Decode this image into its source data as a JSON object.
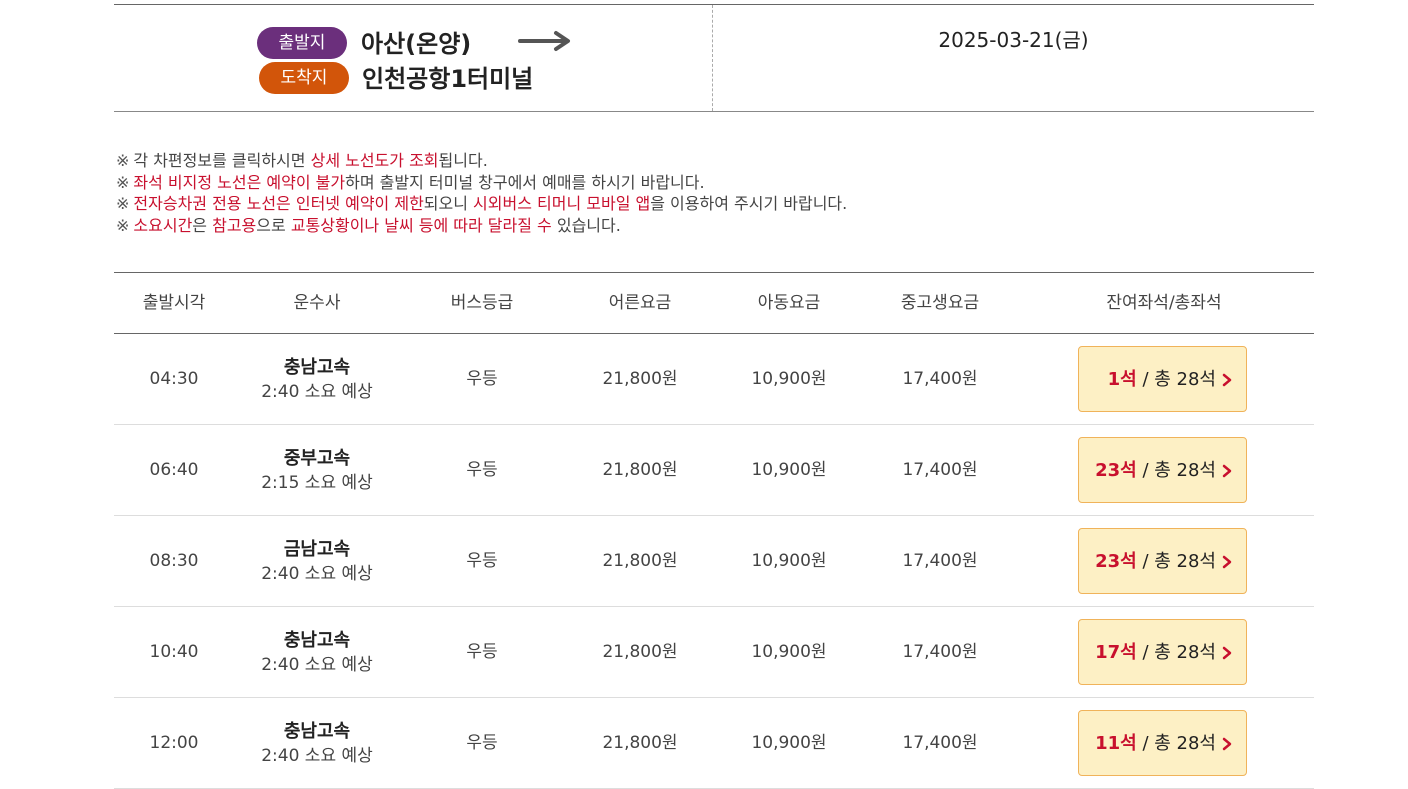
{
  "route": {
    "departure_badge": "출발지",
    "departure": "아산(온양)",
    "arrival_badge": "도착지",
    "arrival": "인천공항1터미널",
    "date": "2025-03-21(금)"
  },
  "notices": [
    [
      {
        "t": "각 차편정보를 클릭하시면 ",
        "red": false
      },
      {
        "t": "상세 노선도가 조회",
        "red": true
      },
      {
        "t": "됩니다.",
        "red": false
      }
    ],
    [
      {
        "t": "좌석 비지정 노선은 예약이 불가",
        "red": true
      },
      {
        "t": "하며 출발지 터미널 창구에서 예매를 하시기 바랍니다.",
        "red": false
      }
    ],
    [
      {
        "t": "전자승차권 전용 노선은 인터넷 예약이 제한",
        "red": true
      },
      {
        "t": "되오니 ",
        "red": false
      },
      {
        "t": "시외버스 티머니 모바일 앱",
        "red": true
      },
      {
        "t": "을 이용하여 주시기 바랍니다.",
        "red": false
      }
    ],
    [
      {
        "t": "소요시간",
        "red": true
      },
      {
        "t": "은 ",
        "red": false
      },
      {
        "t": "참고용",
        "red": true
      },
      {
        "t": "으로 ",
        "red": false
      },
      {
        "t": "교통상황이나 날씨 등에 따라 달라질 수",
        "red": true
      },
      {
        "t": " 있습니다.",
        "red": false
      }
    ]
  ],
  "notice_mark": "※",
  "table": {
    "headers": [
      "출발시각",
      "운수사",
      "버스등급",
      "어른요금",
      "아동요금",
      "중고생요금",
      "잔여좌석/총좌석"
    ],
    "rows": [
      {
        "time": "04:30",
        "company": "충남고속",
        "duration": "2:40 소요 예상",
        "grade": "우등",
        "adult": "21,800원",
        "child": "10,900원",
        "student": "17,400원",
        "remain": "1석",
        "total": "/ 총 28석"
      },
      {
        "time": "06:40",
        "company": "중부고속",
        "duration": "2:15 소요 예상",
        "grade": "우등",
        "adult": "21,800원",
        "child": "10,900원",
        "student": "17,400원",
        "remain": "23석",
        "total": "/ 총 28석"
      },
      {
        "time": "08:30",
        "company": "금남고속",
        "duration": "2:40 소요 예상",
        "grade": "우등",
        "adult": "21,800원",
        "child": "10,900원",
        "student": "17,400원",
        "remain": "23석",
        "total": "/ 총 28석"
      },
      {
        "time": "10:40",
        "company": "충남고속",
        "duration": "2:40 소요 예상",
        "grade": "우등",
        "adult": "21,800원",
        "child": "10,900원",
        "student": "17,400원",
        "remain": "17석",
        "total": "/ 총 28석"
      },
      {
        "time": "12:00",
        "company": "충남고속",
        "duration": "2:40 소요 예상",
        "grade": "우등",
        "adult": "21,800원",
        "child": "10,900원",
        "student": "17,400원",
        "remain": "11석",
        "total": "/ 총 28석"
      }
    ]
  },
  "colors": {
    "departure_badge": "#6b2f7c",
    "arrival_badge": "#d2550a",
    "highlight_red": "#c8102e",
    "seat_button_bg": "#fdf0c5",
    "seat_button_border": "#f0b35a"
  },
  "icons": {
    "route_arrow": "right-arrow-icon",
    "seat_chevron": "chevron-right-icon"
  }
}
